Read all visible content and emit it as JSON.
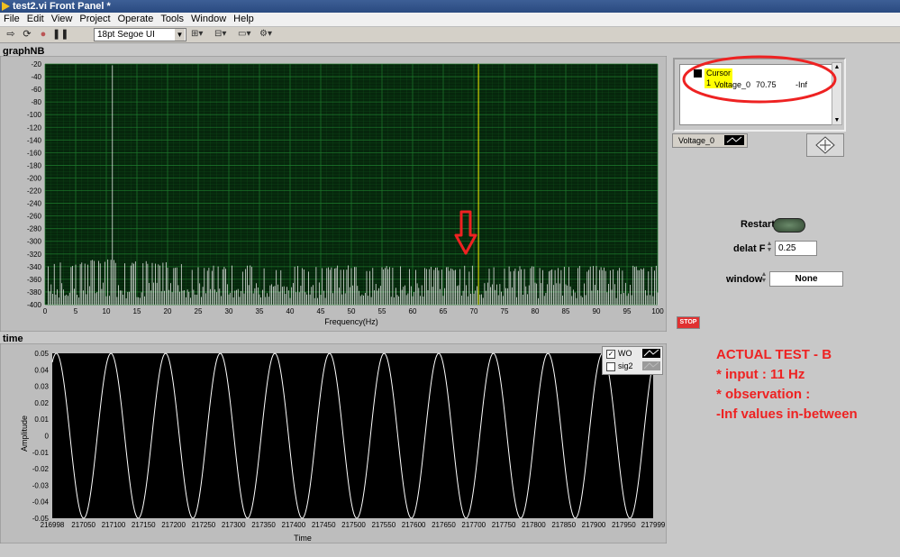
{
  "window": {
    "title": "test2.vi Front Panel *"
  },
  "menu": [
    "File",
    "Edit",
    "View",
    "Project",
    "Operate",
    "Tools",
    "Window",
    "Help"
  ],
  "toolbar": {
    "font_value": "18pt Segoe UI"
  },
  "graph_nb": {
    "label": "graphNB",
    "x_label": "Frequency(Hz)",
    "x_ticks": [
      "0",
      "5",
      "10",
      "15",
      "20",
      "25",
      "30",
      "35",
      "40",
      "45",
      "50",
      "55",
      "60",
      "65",
      "70",
      "75",
      "80",
      "85",
      "90",
      "95",
      "100"
    ],
    "y_ticks": [
      "-20",
      "-40",
      "-60",
      "-80",
      "-100",
      "-120",
      "-140",
      "-160",
      "-180",
      "-200",
      "-220",
      "-240",
      "-260",
      "-280",
      "-300",
      "-320",
      "-340",
      "-360",
      "-380",
      "-400"
    ]
  },
  "cursor_legend": {
    "name": "Cursor 1",
    "plot": "Voltage_0",
    "x": "70.75",
    "y": "-Inf"
  },
  "plot_legend": {
    "name": "Voltage_0"
  },
  "controls": {
    "restart_label": "Restart",
    "delta_f_label": "delat F",
    "delta_f_value": "0.25",
    "window_label": "window",
    "window_value": "None",
    "stop_label": "STOP"
  },
  "time_graph": {
    "label": "time",
    "x_label": "Time",
    "y_label": "Amplitude",
    "x_ticks": [
      "216998",
      "217050",
      "217100",
      "217150",
      "217200",
      "217250",
      "217300",
      "217350",
      "217400",
      "217450",
      "217500",
      "217550",
      "217600",
      "217650",
      "217700",
      "217750",
      "217800",
      "217850",
      "217900",
      "217950",
      "217999"
    ],
    "y_ticks": [
      "0.05",
      "0.04",
      "0.03",
      "0.02",
      "0.01",
      "0",
      "-0.01",
      "-0.02",
      "-0.03",
      "-0.04",
      "-0.05"
    ],
    "legend": [
      {
        "name": "WO",
        "checked": true
      },
      {
        "name": "sig2",
        "checked": false
      }
    ]
  },
  "note": [
    "ACTUAL TEST - B",
    "* input : 11 Hz",
    "* observation :",
    "-Inf values in-between"
  ],
  "chart_data": [
    {
      "type": "line",
      "title": "graphNB",
      "xlabel": "Frequency(Hz)",
      "ylabel": "",
      "xlim": [
        0,
        100
      ],
      "ylim": [
        -400,
        -20
      ],
      "grid": true,
      "series": [
        {
          "name": "Voltage_0",
          "peak_x": 11,
          "peak_y": -22,
          "noise_floor": [
            -390,
            -340
          ]
        }
      ],
      "cursor": {
        "x": 70.75,
        "y": "-Inf"
      }
    },
    {
      "type": "line",
      "title": "time",
      "xlabel": "Time",
      "ylabel": "Amplitude",
      "xlim": [
        216998,
        217999
      ],
      "ylim": [
        -0.05,
        0.05
      ],
      "grid": false,
      "series": [
        {
          "name": "WO",
          "amplitude": 0.05,
          "frequency_hz": 11
        }
      ]
    }
  ],
  "colors": {
    "plot_bg": "#06260c",
    "grid": "#1e7a2c",
    "trace": "#ffffff",
    "cursor": "#f0f000",
    "annotation": "#ee2222"
  }
}
